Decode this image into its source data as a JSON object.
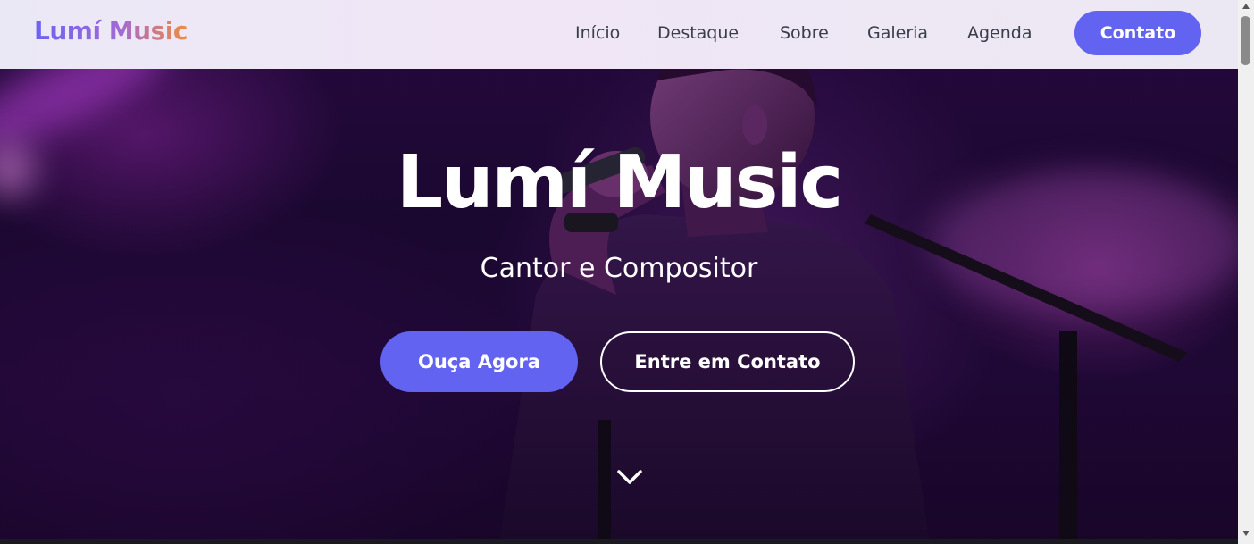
{
  "header": {
    "logo": "Lumí Music",
    "nav": [
      "Início",
      "Destaque",
      "Sobre",
      "Galeria",
      "Agenda"
    ],
    "cta_label": "Contato"
  },
  "hero": {
    "title": "Lumí Music",
    "subtitle": "Cantor e Compositor",
    "primary_button": "Ouça Agora",
    "secondary_button": "Entre em Contato",
    "scroll_icon": "chevron-down-icon"
  },
  "colors": {
    "accent": "#6363f1",
    "header_bg": "#ede8f5",
    "hero_bg": "#22093a",
    "text_on_hero": "#ffffff",
    "nav_text": "#3a3d4a"
  }
}
